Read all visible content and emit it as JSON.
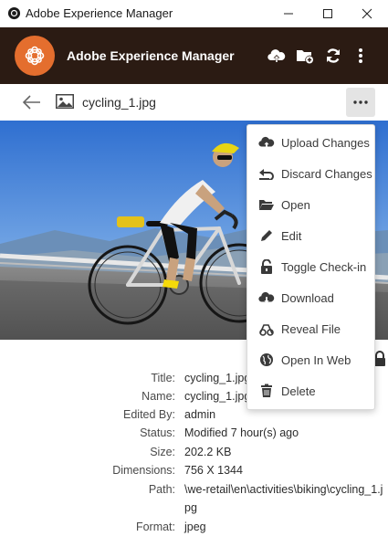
{
  "window": {
    "title": "Adobe Experience Manager"
  },
  "appbar": {
    "title": "Adobe Experience Manager"
  },
  "asset": {
    "filename": "cycling_1.jpg"
  },
  "menu": {
    "items": [
      {
        "label": "Upload Changes",
        "icon": "cloud-upload-icon"
      },
      {
        "label": "Discard Changes",
        "icon": "undo-icon"
      },
      {
        "label": "Open",
        "icon": "folder-open-icon"
      },
      {
        "label": "Edit",
        "icon": "pencil-icon"
      },
      {
        "label": "Toggle Check-in",
        "icon": "lock-open-icon"
      },
      {
        "label": "Download",
        "icon": "cloud-download-icon"
      },
      {
        "label": "Reveal File",
        "icon": "reveal-file-icon"
      },
      {
        "label": "Open In Web",
        "icon": "globe-icon"
      },
      {
        "label": "Delete",
        "icon": "trash-icon"
      }
    ]
  },
  "properties": [
    {
      "key": "Title:",
      "value": "cycling_1.jpg"
    },
    {
      "key": "Name:",
      "value": "cycling_1.jpg"
    },
    {
      "key": "Edited By:",
      "value": "admin"
    },
    {
      "key": "Status:",
      "value": "Modified 7 hour(s) ago"
    },
    {
      "key": "Size:",
      "value": "202.2 KB"
    },
    {
      "key": "Dimensions:",
      "value": "756 X 1344"
    },
    {
      "key": "Path:",
      "value": "\\we-retail\\en\\activities\\biking\\cycling_1.jpg"
    },
    {
      "key": "Format:",
      "value": "jpeg"
    }
  ],
  "colors": {
    "appbar": "#2b1b13",
    "logo": "#e46e2e"
  }
}
